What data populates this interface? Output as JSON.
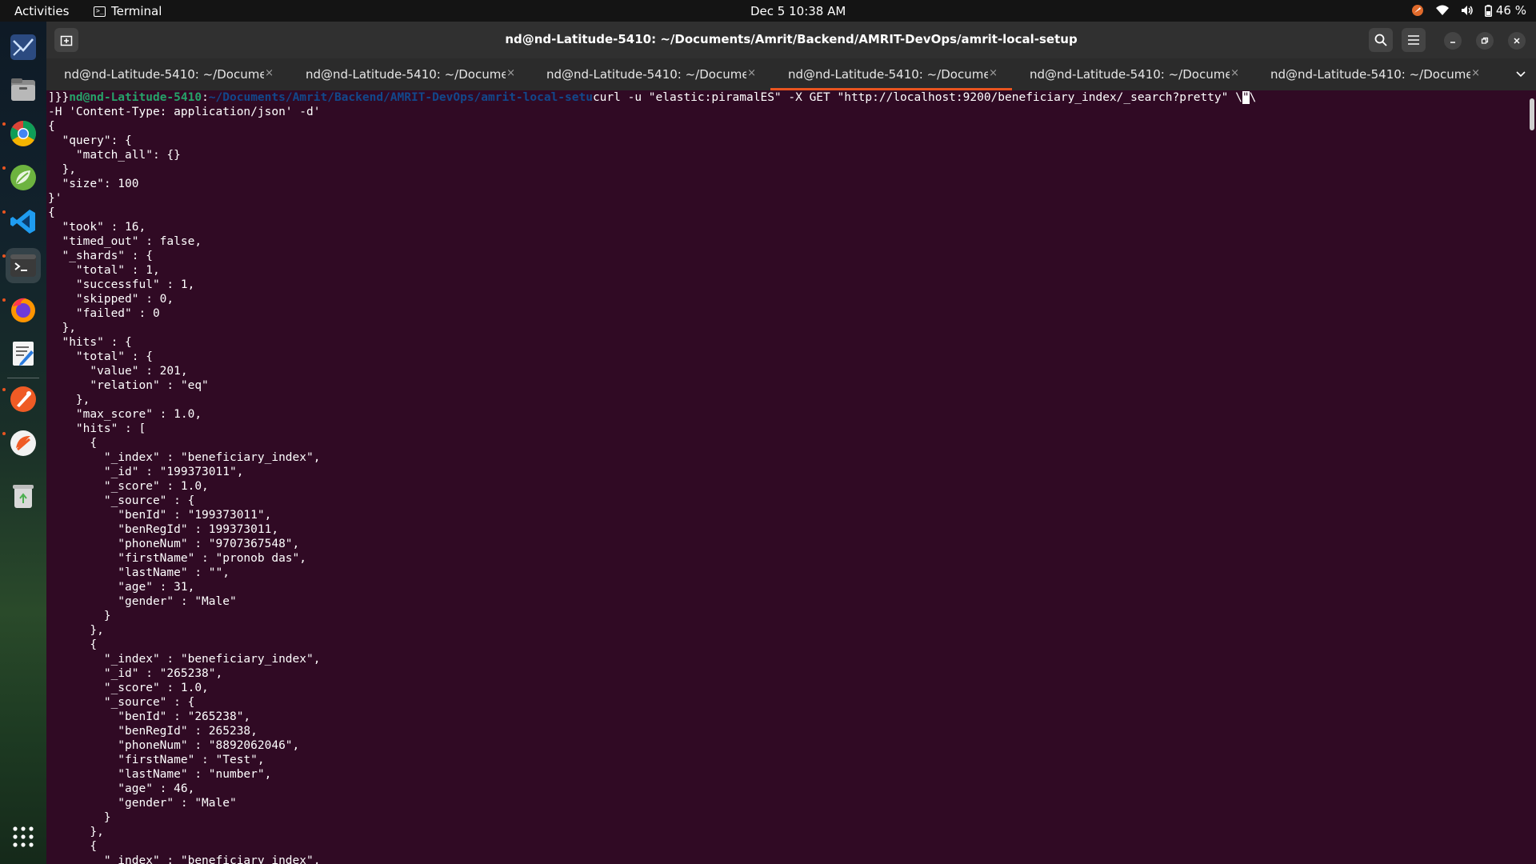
{
  "topbar": {
    "activities": "Activities",
    "app_name": "Terminal",
    "clock": "Dec 5  10:38 AM",
    "battery": "46 %"
  },
  "dock": {
    "items": [
      {
        "name": "network-app-icon"
      },
      {
        "name": "files-icon"
      },
      {
        "name": "chrome-icon"
      },
      {
        "name": "spring-tool-icon"
      },
      {
        "name": "vscode-icon"
      },
      {
        "name": "terminal-icon"
      },
      {
        "name": "firefox-icon"
      },
      {
        "name": "text-editor-icon"
      },
      {
        "name": "postman-icon"
      },
      {
        "name": "postman-agent-icon"
      },
      {
        "name": "trash-icon"
      },
      {
        "name": "app-grid-icon"
      }
    ]
  },
  "window": {
    "title": "nd@nd-Latitude-5410: ~/Documents/Amrit/Backend/AMRIT-DevOps/amrit-local-setup",
    "tabs": [
      {
        "label": "nd@nd-Latitude-5410: ~/Docume...",
        "close": "×",
        "active": false
      },
      {
        "label": "nd@nd-Latitude-5410: ~/Docume...",
        "close": "×",
        "active": false
      },
      {
        "label": "nd@nd-Latitude-5410: ~/Docume...",
        "close": "×",
        "active": false
      },
      {
        "label": "nd@nd-Latitude-5410: ~/Docume...",
        "close": "×",
        "active": true
      },
      {
        "label": "nd@nd-Latitude-5410: ~/Docume...",
        "close": "×",
        "active": false
      },
      {
        "label": "nd@nd-Latitude-5410: ~/Docume...",
        "close": "×",
        "active": false
      }
    ]
  },
  "terminal": {
    "prompt_prefix": "]}}",
    "prompt_user": "nd@nd-Latitude-5410",
    "prompt_sep": ":",
    "prompt_path": "~/Documents/Amrit/Backend/AMRIT-DevOps/amrit-local-setu",
    "command": "curl -u \"elastic:piramalES\" -X GET \"http://localhost:9200/beneficiary_index/_search?pretty\" \\",
    "cursor_text": "\"",
    "cursor_trail": "\\",
    "lines": [
      "-H 'Content-Type: application/json' -d'",
      "{",
      "  \"query\": {",
      "    \"match_all\": {}",
      "  },",
      "  \"size\": 100",
      "}'",
      "{",
      "  \"took\" : 16,",
      "  \"timed_out\" : false,",
      "  \"_shards\" : {",
      "    \"total\" : 1,",
      "    \"successful\" : 1,",
      "    \"skipped\" : 0,",
      "    \"failed\" : 0",
      "  },",
      "  \"hits\" : {",
      "    \"total\" : {",
      "      \"value\" : 201,",
      "      \"relation\" : \"eq\"",
      "    },",
      "    \"max_score\" : 1.0,",
      "    \"hits\" : [",
      "      {",
      "        \"_index\" : \"beneficiary_index\",",
      "        \"_id\" : \"199373011\",",
      "        \"_score\" : 1.0,",
      "        \"_source\" : {",
      "          \"benId\" : \"199373011\",",
      "          \"benRegId\" : 199373011,",
      "          \"phoneNum\" : \"9707367548\",",
      "          \"firstName\" : \"pronob das\",",
      "          \"lastName\" : \"\",",
      "          \"age\" : 31,",
      "          \"gender\" : \"Male\"",
      "        }",
      "      },",
      "      {",
      "        \"_index\" : \"beneficiary_index\",",
      "        \"_id\" : \"265238\",",
      "        \"_score\" : 1.0,",
      "        \"_source\" : {",
      "          \"benId\" : \"265238\",",
      "          \"benRegId\" : 265238,",
      "          \"phoneNum\" : \"8892062046\",",
      "          \"firstName\" : \"Test\",",
      "          \"lastName\" : \"number\",",
      "          \"age\" : 46,",
      "          \"gender\" : \"Male\"",
      "        }",
      "      },",
      "      {",
      "        \"_index\" : \"beneficiary_index\","
    ]
  },
  "colors": {
    "terminal_bg": "#300a24",
    "accent": "#e95420",
    "prompt_user": "#26a269",
    "prompt_path": "#12488b"
  }
}
